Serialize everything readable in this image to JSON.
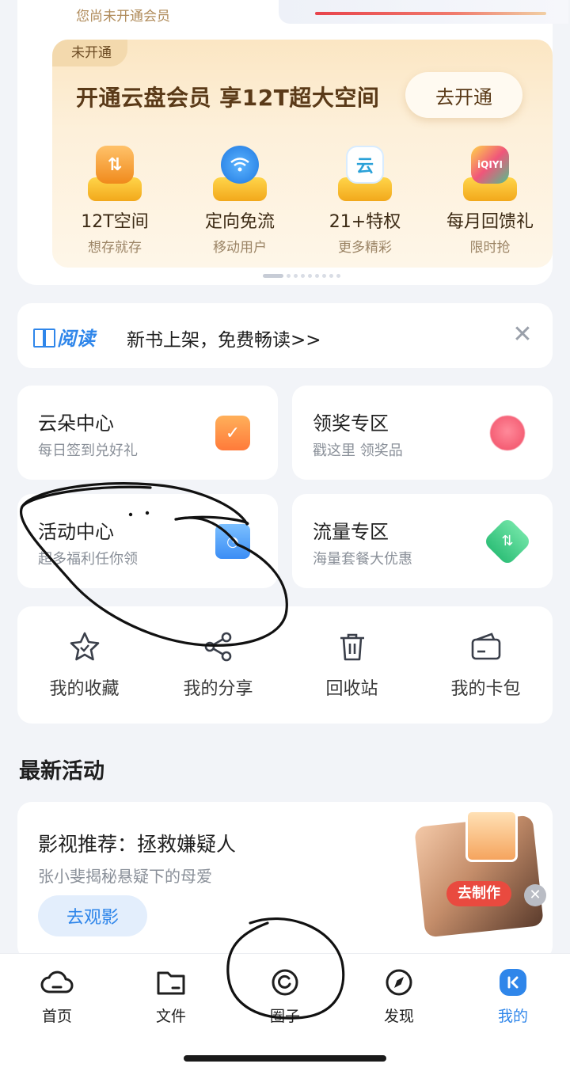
{
  "membership": {
    "status_text": "您尚未开通会员",
    "tag": "未开通",
    "headline": "开通云盘会员 享12T超大空间",
    "cta": "去开通",
    "perks": [
      {
        "title": "12T空间",
        "subtitle": "想存就存",
        "icon": "storage-box-icon",
        "color": "#f39b2c"
      },
      {
        "title": "定向免流",
        "subtitle": "移动用户",
        "icon": "wifi-icon",
        "color": "#2f86ea"
      },
      {
        "title": "21+特权",
        "subtitle": "更多精彩",
        "icon": "cloud-logo-icon",
        "color": "#2aa1d8"
      },
      {
        "title": "每月回馈礼",
        "subtitle": "限时抢",
        "icon": "partner-gift-icon",
        "color": "#f0567a"
      }
    ]
  },
  "reading_banner": {
    "logo": "阅读",
    "text": "新书上架，免费畅读>>",
    "close_glyph": "✕"
  },
  "tiles": [
    {
      "title": "云朵中心",
      "subtitle": "每日签到兑好礼",
      "icon": "calendar-check-icon"
    },
    {
      "title": "领奖专区",
      "subtitle": "戳这里 领奖品",
      "icon": "gift-icon"
    },
    {
      "title": "活动中心",
      "subtitle": "超多福利任你领",
      "icon": "folder-clock-icon"
    },
    {
      "title": "流量专区",
      "subtitle": "海量套餐大优惠",
      "icon": "data-flow-icon"
    }
  ],
  "quick_actions": [
    {
      "label": "我的收藏",
      "icon": "star-icon"
    },
    {
      "label": "我的分享",
      "icon": "share-icon"
    },
    {
      "label": "回收站",
      "icon": "trash-icon"
    },
    {
      "label": "我的卡包",
      "icon": "card-wallet-icon"
    }
  ],
  "latest": {
    "section_title": "最新活动",
    "card_title": "影视推荐：拯救嫌疑人",
    "card_subtitle": "张小斐揭秘悬疑下的母爱",
    "card_button": "去观影",
    "art_button": "去制作"
  },
  "bottom_nav": [
    {
      "label": "首页",
      "icon": "cloud-home-icon",
      "active": false
    },
    {
      "label": "文件",
      "icon": "folder-icon",
      "active": false
    },
    {
      "label": "圈子",
      "icon": "circle-icon",
      "active": false
    },
    {
      "label": "发现",
      "icon": "compass-icon",
      "active": false
    },
    {
      "label": "我的",
      "icon": "profile-icon",
      "active": true
    }
  ],
  "colors": {
    "accent": "#2f86ea",
    "vip_gold": "#fbe6c3",
    "vip_text": "#5a3a18",
    "background": "#f2f4f8"
  }
}
